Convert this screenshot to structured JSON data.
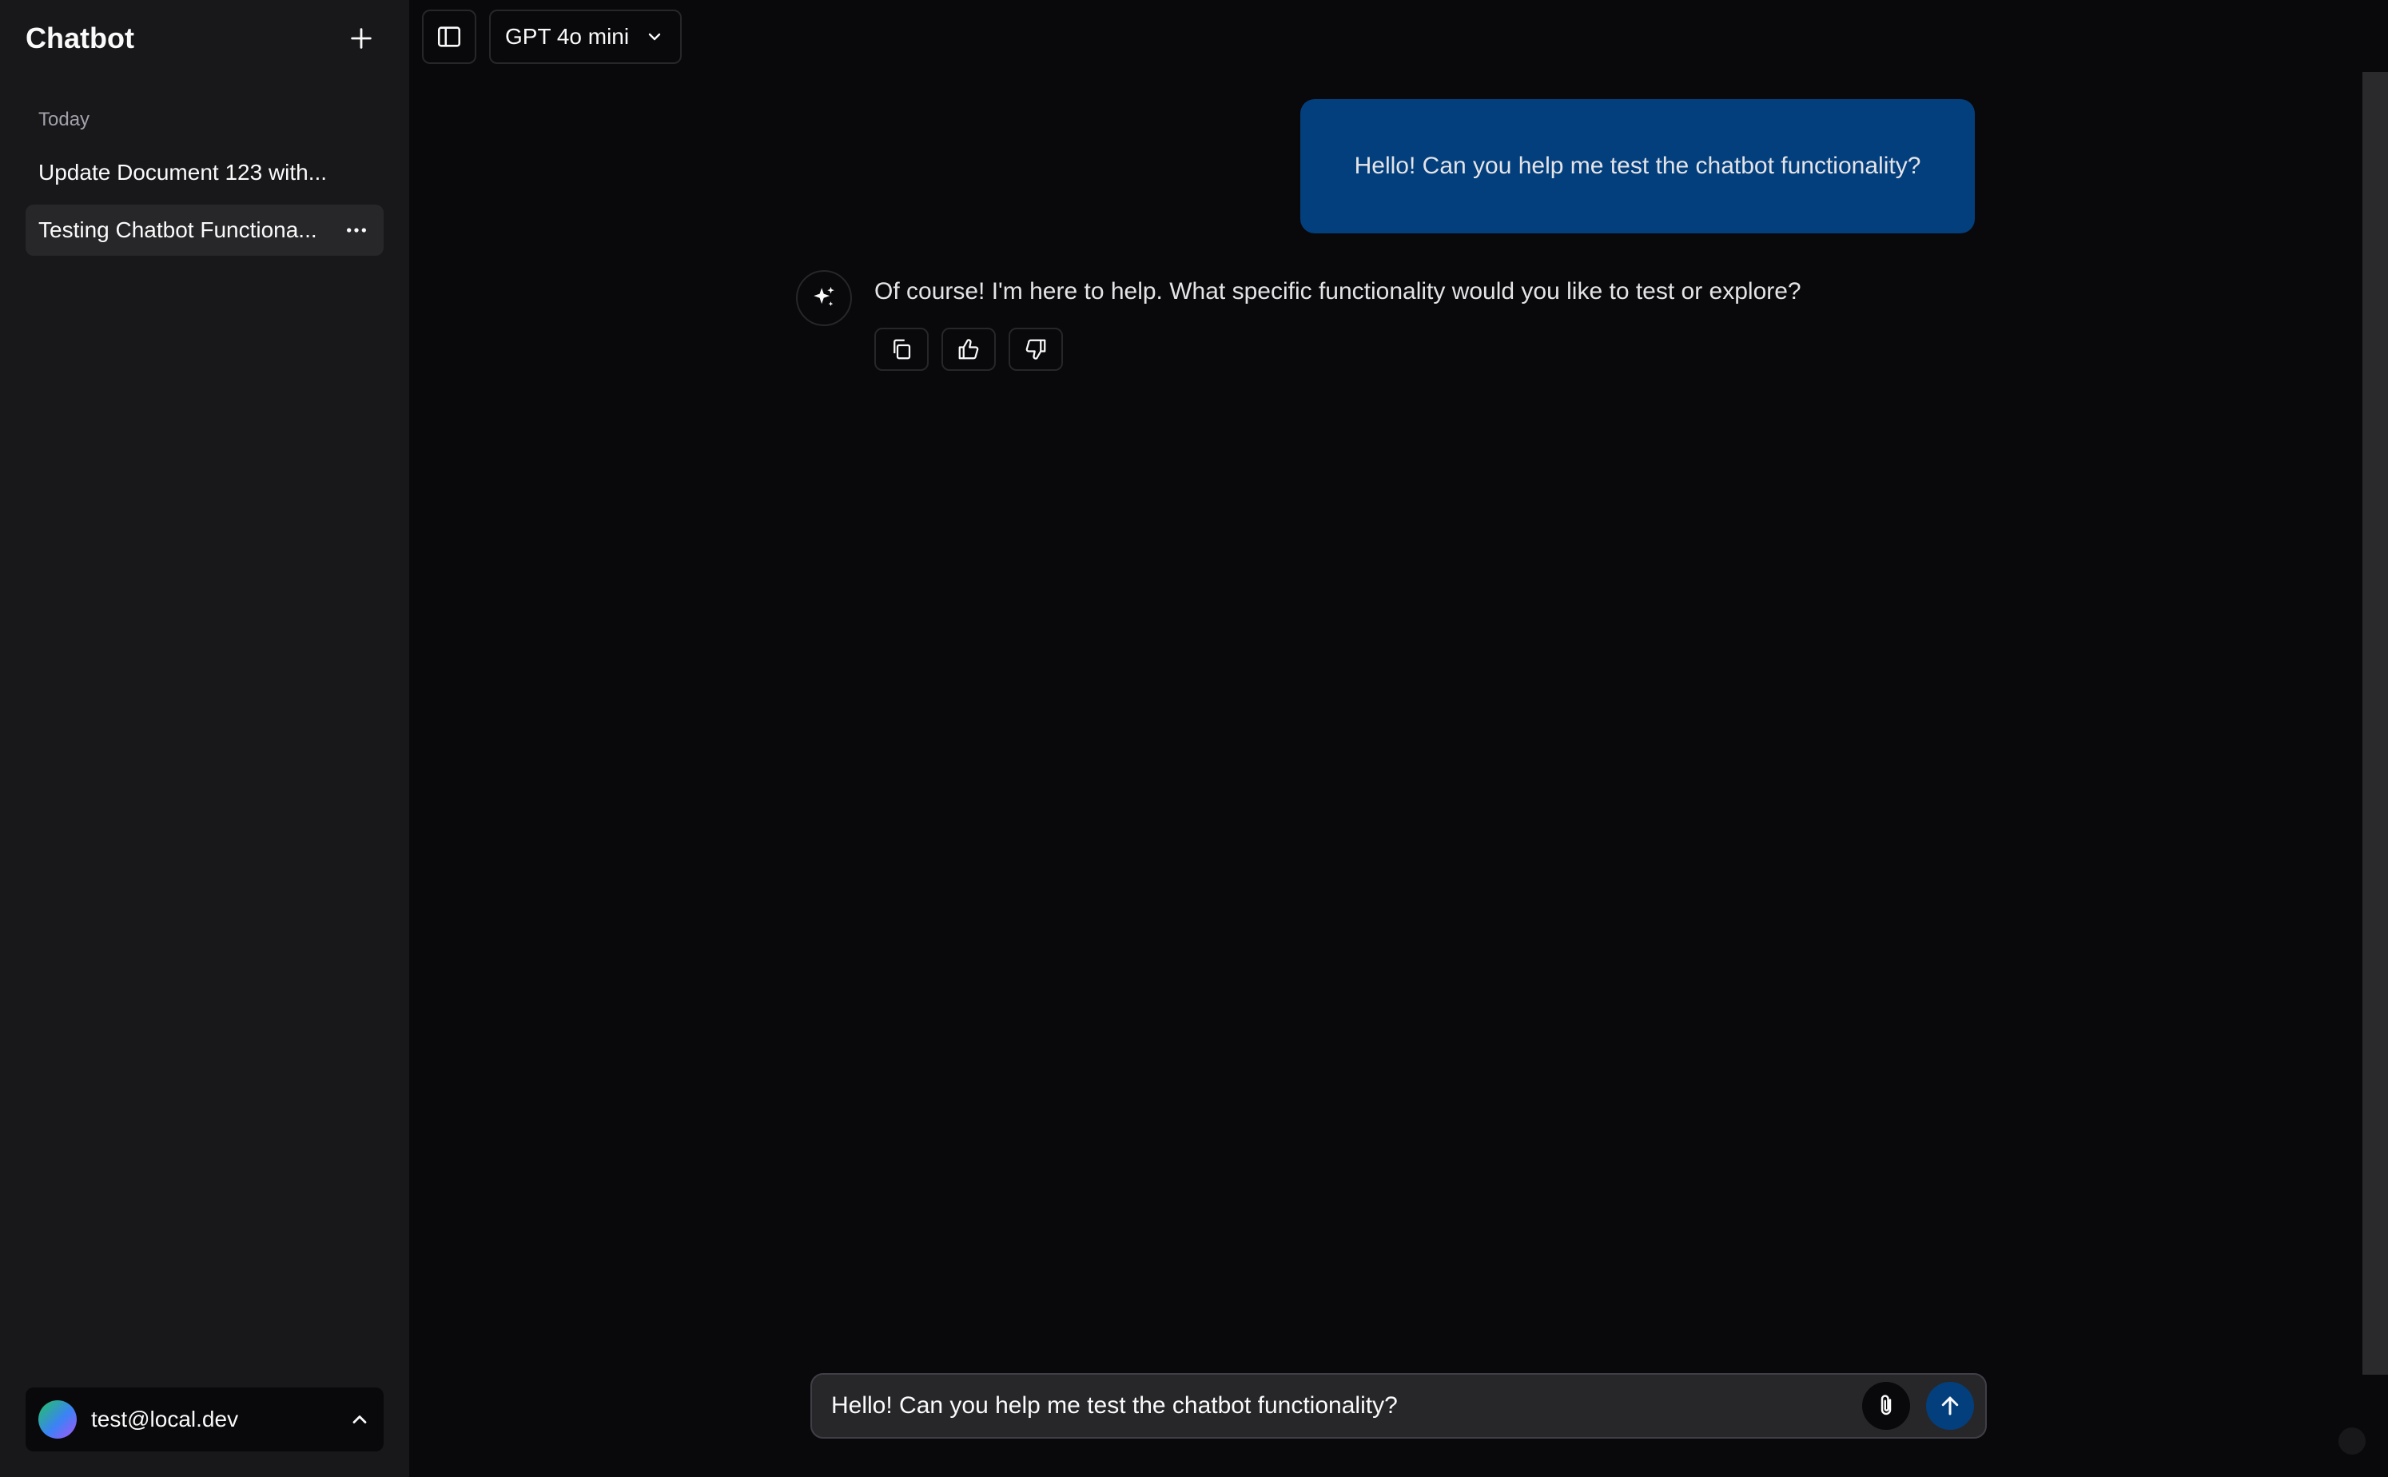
{
  "app": {
    "title": "Chatbot"
  },
  "sidebar": {
    "section_label": "Today",
    "items": [
      {
        "label": "Update Document 123 with..."
      },
      {
        "label": "Testing Chatbot Functiona..."
      }
    ],
    "user": {
      "email": "test@local.dev"
    }
  },
  "topbar": {
    "model_label": "GPT 4o mini"
  },
  "conversation": {
    "user_message": "Hello! Can you help me test the chatbot functionality?",
    "assistant_message": "Of course! I'm here to help. What specific functionality would you like to test or explore?"
  },
  "composer": {
    "value": "Hello! Can you help me test the chatbot functionality?"
  },
  "colors": {
    "accent": "#033f7d",
    "sidebar_bg": "#18181b",
    "main_bg": "#09090b",
    "border": "#27272a"
  },
  "icons": {
    "new_chat": "plus-icon",
    "more": "more-horizontal-icon",
    "user_menu": "chevron-up-icon",
    "sidebar_toggle": "sidebar-toggle-icon",
    "model_dropdown": "chevron-down-icon",
    "assistant": "sparkles-icon",
    "copy": "copy-icon",
    "upvote": "thumbs-up-icon",
    "downvote": "thumbs-down-icon",
    "attach": "paperclip-icon",
    "send": "arrow-up-icon"
  }
}
